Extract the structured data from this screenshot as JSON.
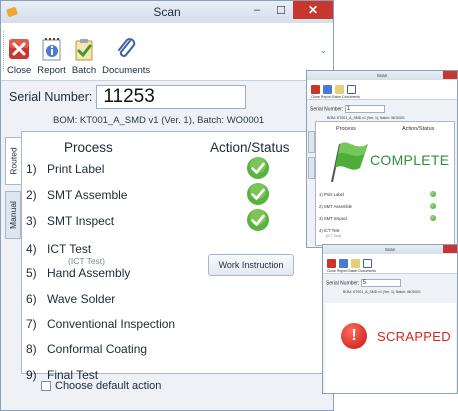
{
  "main_window": {
    "title": "Scan",
    "controls": {
      "minimize": "–",
      "maximize": "☐",
      "close": "✕"
    },
    "toolbar": {
      "buttons": [
        {
          "id": "close",
          "label": "Close",
          "icon": "close-icon",
          "color": "#c7372f"
        },
        {
          "id": "report",
          "label": "Report",
          "icon": "report-icon",
          "color": "#4a7bd4"
        },
        {
          "id": "batch",
          "label": "Batch",
          "icon": "batch-icon",
          "color": "#6aa84f"
        },
        {
          "id": "documents",
          "label": "Documents",
          "icon": "paperclip-icon",
          "color": "#3d62a8"
        }
      ],
      "more": "⌄"
    },
    "serial": {
      "label": "Serial Number:",
      "value": "11253"
    },
    "bom": "BOM: KT001_A_SMD v1 (Ver. 1), Batch: WO0001",
    "tabs": [
      {
        "label": "Routed",
        "active": true
      },
      {
        "label": "Manual",
        "active": false
      }
    ],
    "headers": {
      "process": "Process",
      "action": "Action/Status"
    },
    "steps": [
      {
        "num": "1)",
        "name": "Print Label",
        "done": true
      },
      {
        "num": "2)",
        "name": "SMT Assemble",
        "done": true
      },
      {
        "num": "3)",
        "name": "SMT Inspect",
        "done": true
      },
      {
        "num": "4)",
        "name": "ICT Test",
        "sub": "(ICT Test)",
        "action": "Work Instruction"
      },
      {
        "num": "5)",
        "name": "Hand Assembly"
      },
      {
        "num": "6)",
        "name": "Wave Solder"
      },
      {
        "num": "7)",
        "name": "Conventional Inspection"
      },
      {
        "num": "8)",
        "name": "Conformal Coating"
      },
      {
        "num": "9)",
        "name": "Final Test"
      }
    ],
    "default_action": {
      "label": "Choose default action",
      "checked": false
    }
  },
  "mini_window_complete": {
    "title": "Scan",
    "toolbar_labels": "Close  Report  Batch  Documents",
    "serial_label": "Serial Number:",
    "serial_value": "1",
    "bom": "BOM: KT001_A_SMD v1 (Ver. 1), Batch: WO0001",
    "headers": {
      "process": "Process",
      "action": "Action/Status"
    },
    "status": "COMPLETE",
    "status_color": "#2f8e3c",
    "steps": [
      {
        "name": "1) Print Label"
      },
      {
        "name": "2) SMT Assemble"
      },
      {
        "name": "3) SMT Inspect"
      },
      {
        "name": "4) ICT Test",
        "sub": "(ICT Test)"
      }
    ]
  },
  "mini_window_scrapped": {
    "title": "Scan",
    "toolbar_labels": "Close  Report  Batch  Documents",
    "serial_label": "Serial Number:",
    "serial_value": "5",
    "bom": "BOM: KT001_A_SMD v1 (Ver. 1), Batch: WO0001",
    "status": "SCRAPPED",
    "status_color": "#d6261b"
  }
}
